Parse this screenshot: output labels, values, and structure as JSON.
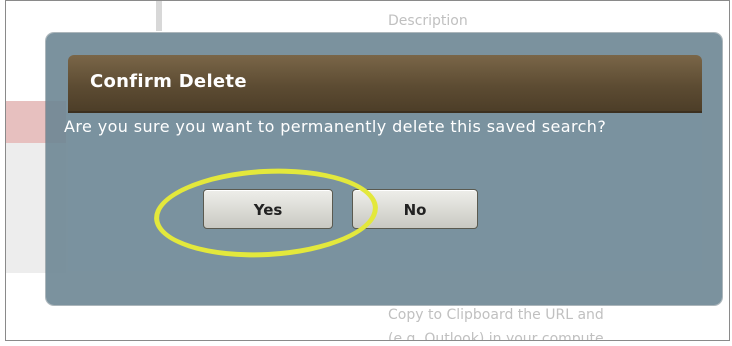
{
  "background": {
    "description_label": "Description",
    "copy_line_1": "Copy to Clipboard the URL and",
    "copy_line_2": "(e.g. Outlook) in your compute"
  },
  "dialog": {
    "title": "Confirm Delete",
    "message": "Are you sure you want to permanently delete this saved search?",
    "yes_label": "Yes",
    "no_label": "No"
  },
  "colors": {
    "titlebar": "#5d4c33",
    "overlay": "#6d8694",
    "highlight": "#e3e83c"
  }
}
